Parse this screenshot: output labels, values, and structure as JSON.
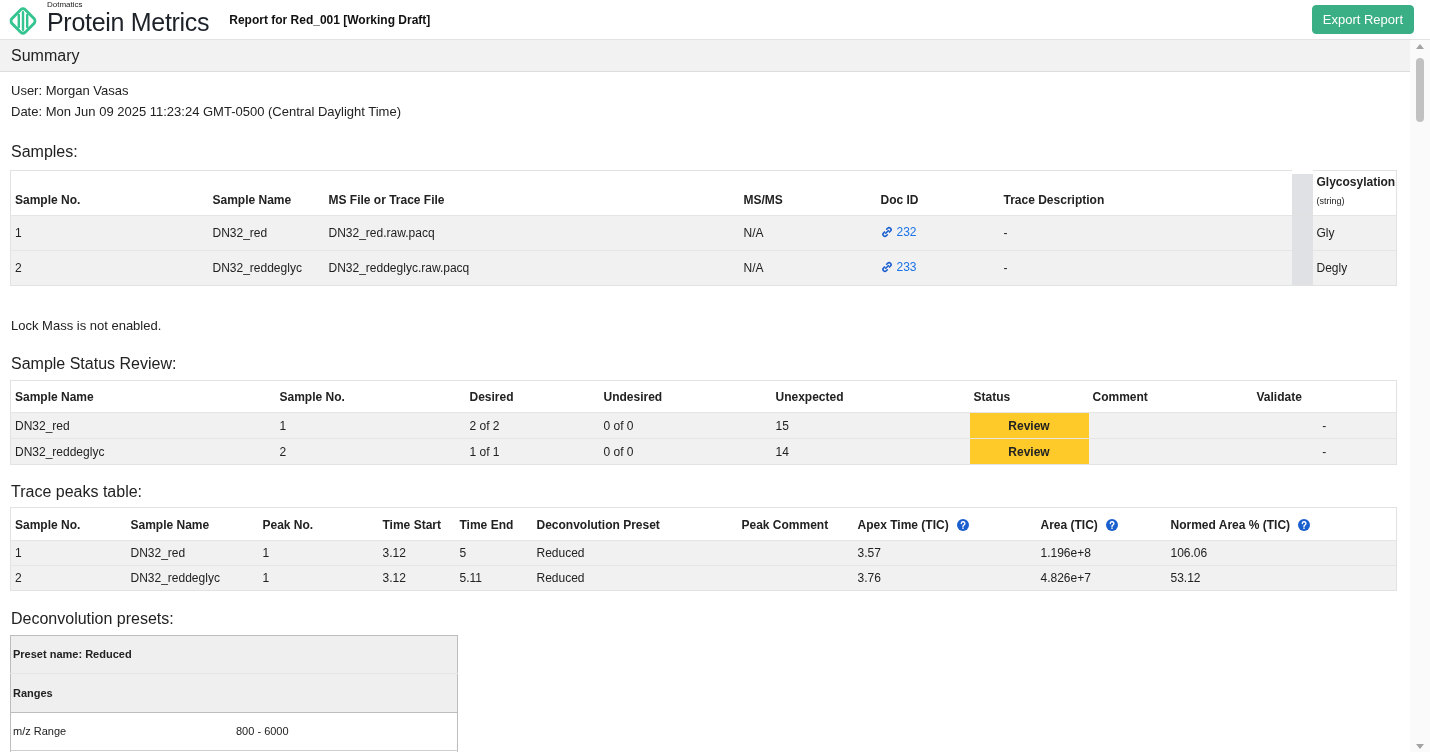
{
  "header": {
    "brand_caption": "Dotmatics",
    "brand_name": "Protein Metrics",
    "report_title": "Report for Red_001 [Working Draft]",
    "export_button": "Export Report"
  },
  "summary": {
    "title": "Summary",
    "user": "User: Morgan Vasas",
    "date": "Date: Mon Jun 09 2025 11:23:24 GMT-0500 (Central Daylight Time)"
  },
  "samples": {
    "heading": "Samples:",
    "columns": [
      {
        "label": "Sample No.",
        "kind": "text"
      },
      {
        "label": "Sample Name",
        "kind": "text"
      },
      {
        "label": "MS File or Trace File",
        "kind": "text"
      },
      {
        "label": "MS/MS",
        "kind": "text"
      },
      {
        "label": "Doc ID",
        "kind": "link"
      },
      {
        "label": "Trace Description",
        "kind": "text"
      },
      {
        "label": "Glycosylation",
        "note": "(string)",
        "kind": "text"
      }
    ],
    "rows": [
      {
        "sample_no": "1",
        "sample_name": "DN32_red",
        "file": "DN32_red.raw.pacq",
        "msms": "N/A",
        "doc_id": "232",
        "trace_description": "-",
        "glycosylation": "Gly"
      },
      {
        "sample_no": "2",
        "sample_name": "DN32_reddeglyc",
        "file": "DN32_reddeglyc.raw.pacq",
        "msms": "N/A",
        "doc_id": "233",
        "trace_description": "-",
        "glycosylation": "Degly"
      }
    ]
  },
  "lock_mass_note": "Lock Mass is not enabled.",
  "status_review": {
    "heading": "Sample Status Review:",
    "columns": [
      {
        "label": "Sample Name",
        "kind": "text"
      },
      {
        "label": "Sample No.",
        "kind": "text"
      },
      {
        "label": "Desired",
        "kind": "text"
      },
      {
        "label": "Undesired",
        "kind": "text"
      },
      {
        "label": "Unexpected",
        "kind": "text"
      },
      {
        "label": "Status",
        "kind": "status"
      },
      {
        "label": "Comment",
        "kind": "text"
      },
      {
        "label": "Validate",
        "kind": "text"
      }
    ],
    "rows": [
      {
        "sample_name": "DN32_red",
        "sample_no": "1",
        "desired": "2 of 2",
        "undesired": "0 of 0",
        "unexpected": "15",
        "status": {
          "label": "Review",
          "kind": "review"
        },
        "validate": "-"
      },
      {
        "sample_name": "DN32_reddeglyc",
        "sample_no": "2",
        "desired": "1 of 1",
        "undesired": "0 of 0",
        "unexpected": "14",
        "status": {
          "label": "Review",
          "kind": "review"
        },
        "validate": "-"
      }
    ]
  },
  "trace_peaks": {
    "heading": "Trace peaks table:",
    "columns": [
      {
        "label": "Sample No.",
        "help": false
      },
      {
        "label": "Sample Name",
        "help": false
      },
      {
        "label": "Peak No.",
        "help": false
      },
      {
        "label": "Time Start",
        "help": false
      },
      {
        "label": "Time End",
        "help": false
      },
      {
        "label": "Deconvolution Preset",
        "help": false
      },
      {
        "label": "Peak Comment",
        "help": false
      },
      {
        "label": "Apex Time (TIC)",
        "help": true
      },
      {
        "label": "Area (TIC)",
        "help": true
      },
      {
        "label": "Normed Area % (TIC)",
        "help": true
      }
    ],
    "rows": [
      {
        "sample_no": "1",
        "sample_name": "DN32_red",
        "peak_no": "1",
        "time_start": "3.12",
        "time_end": "5",
        "preset": "Reduced",
        "apex_time": "3.57",
        "area": "1.196e+8",
        "normed_area": "106.06"
      },
      {
        "sample_no": "2",
        "sample_name": "DN32_reddeglyc",
        "peak_no": "1",
        "time_start": "3.12",
        "time_end": "5.11",
        "preset": "Reduced",
        "apex_time": "3.76",
        "area": "4.826e+7",
        "normed_area": "53.12"
      }
    ]
  },
  "deconvolution_presets": {
    "heading": "Deconvolution presets:",
    "presets": [
      {
        "name": "Preset name: Reduced",
        "groups": [
          {
            "title": "Ranges",
            "rows": [
              {
                "label": "m/z Range",
                "value": "800 - 6000"
              }
            ]
          }
        ]
      }
    ]
  }
}
